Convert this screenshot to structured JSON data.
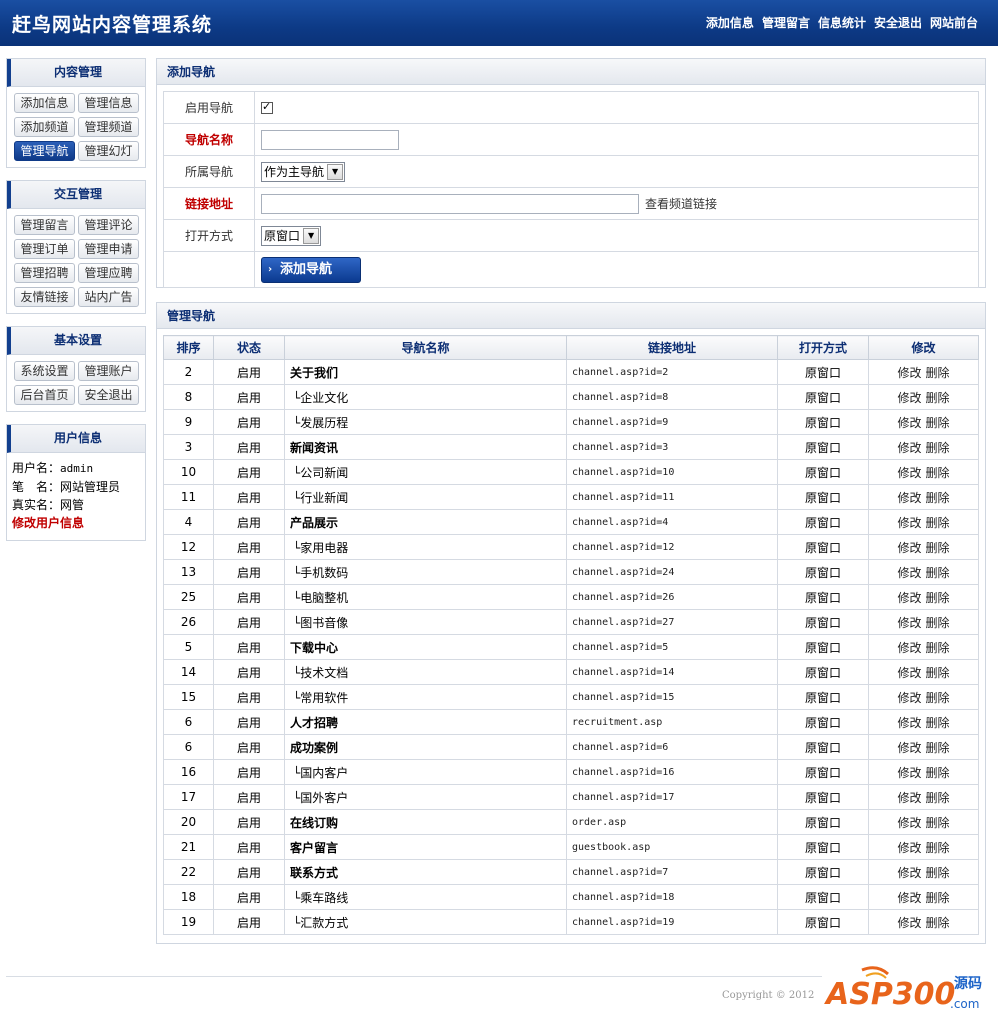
{
  "header": {
    "title": "赶鸟网站内容管理系统",
    "nav": [
      "添加信息",
      "管理留言",
      "信息统计",
      "安全退出",
      "网站前台"
    ]
  },
  "sidebar": {
    "groups": [
      {
        "title": "内容管理",
        "items": [
          "添加信息",
          "管理信息",
          "添加频道",
          "管理频道",
          "管理导航",
          "管理幻灯"
        ]
      },
      {
        "title": "交互管理",
        "items": [
          "管理留言",
          "管理评论",
          "管理订单",
          "管理申请",
          "管理招聘",
          "管理应聘",
          "友情链接",
          "站内广告"
        ]
      },
      {
        "title": "基本设置",
        "items": [
          "系统设置",
          "管理账户",
          "后台首页",
          "安全退出"
        ]
      }
    ],
    "active_item": "管理导航",
    "user": {
      "title": "用户信息",
      "username_label": "用户名：",
      "username": "admin",
      "role_label": "笔　名：",
      "role": "网站管理员",
      "realname_label": "真实名：",
      "realname": "网管",
      "edit_link": "修改用户信息"
    }
  },
  "add_form": {
    "title": "添加导航",
    "enable_label": "启用导航",
    "enable_checked": true,
    "name_label": "导航名称",
    "name_value": "",
    "parent_label": "所属导航",
    "parent_value": "作为主导航",
    "url_label": "链接地址",
    "url_value": "",
    "url_hint": "查看频道链接",
    "target_label": "打开方式",
    "target_value": "原窗口",
    "submit_label": "添加导航"
  },
  "manage": {
    "title": "管理导航",
    "columns": [
      "排序",
      "状态",
      "导航名称",
      "链接地址",
      "打开方式",
      "修改"
    ],
    "edit_label": "修改",
    "delete_label": "删除",
    "rows": [
      {
        "order": "2",
        "status": "启用",
        "name": "关于我们",
        "level": "top",
        "url": "channel.asp?id=2",
        "target": "原窗口"
      },
      {
        "order": "8",
        "status": "启用",
        "name": "└企业文化",
        "level": "child",
        "url": "channel.asp?id=8",
        "target": "原窗口"
      },
      {
        "order": "9",
        "status": "启用",
        "name": "└发展历程",
        "level": "child",
        "url": "channel.asp?id=9",
        "target": "原窗口"
      },
      {
        "order": "3",
        "status": "启用",
        "name": "新闻资讯",
        "level": "top",
        "url": "channel.asp?id=3",
        "target": "原窗口"
      },
      {
        "order": "10",
        "status": "启用",
        "name": "└公司新闻",
        "level": "child",
        "url": "channel.asp?id=10",
        "target": "原窗口"
      },
      {
        "order": "11",
        "status": "启用",
        "name": "└行业新闻",
        "level": "child",
        "url": "channel.asp?id=11",
        "target": "原窗口"
      },
      {
        "order": "4",
        "status": "启用",
        "name": "产品展示",
        "level": "top",
        "url": "channel.asp?id=4",
        "target": "原窗口"
      },
      {
        "order": "12",
        "status": "启用",
        "name": "└家用电器",
        "level": "child",
        "url": "channel.asp?id=12",
        "target": "原窗口"
      },
      {
        "order": "13",
        "status": "启用",
        "name": "└手机数码",
        "level": "child",
        "url": "channel.asp?id=24",
        "target": "原窗口"
      },
      {
        "order": "25",
        "status": "启用",
        "name": "└电脑整机",
        "level": "child",
        "url": "channel.asp?id=26",
        "target": "原窗口"
      },
      {
        "order": "26",
        "status": "启用",
        "name": "└图书音像",
        "level": "child",
        "url": "channel.asp?id=27",
        "target": "原窗口"
      },
      {
        "order": "5",
        "status": "启用",
        "name": "下载中心",
        "level": "top",
        "url": "channel.asp?id=5",
        "target": "原窗口"
      },
      {
        "order": "14",
        "status": "启用",
        "name": "└技术文档",
        "level": "child",
        "url": "channel.asp?id=14",
        "target": "原窗口"
      },
      {
        "order": "15",
        "status": "启用",
        "name": "└常用软件",
        "level": "child",
        "url": "channel.asp?id=15",
        "target": "原窗口"
      },
      {
        "order": "6",
        "status": "启用",
        "name": "人才招聘",
        "level": "top",
        "url": "recruitment.asp",
        "target": "原窗口"
      },
      {
        "order": "6",
        "status": "启用",
        "name": "成功案例",
        "level": "top",
        "url": "channel.asp?id=6",
        "target": "原窗口"
      },
      {
        "order": "16",
        "status": "启用",
        "name": "└国内客户",
        "level": "child",
        "url": "channel.asp?id=16",
        "target": "原窗口"
      },
      {
        "order": "17",
        "status": "启用",
        "name": "└国外客户",
        "level": "child",
        "url": "channel.asp?id=17",
        "target": "原窗口"
      },
      {
        "order": "20",
        "status": "启用",
        "name": "在线订购",
        "level": "top",
        "url": "order.asp",
        "target": "原窗口"
      },
      {
        "order": "21",
        "status": "启用",
        "name": "客户留言",
        "level": "top",
        "url": "guestbook.asp",
        "target": "原窗口"
      },
      {
        "order": "22",
        "status": "启用",
        "name": "联系方式",
        "level": "top",
        "url": "channel.asp?id=7",
        "target": "原窗口"
      },
      {
        "order": "18",
        "status": "启用",
        "name": "└乘车路线",
        "level": "child",
        "url": "channel.asp?id=18",
        "target": "原窗口"
      },
      {
        "order": "19",
        "status": "启用",
        "name": "└汇款方式",
        "level": "child",
        "url": "channel.asp?id=19",
        "target": "原窗口"
      }
    ]
  },
  "footer": {
    "copyright": "Copyright © 2012",
    "logo_text": "ASP300",
    "logo_sub": "源码",
    "logo_domain": ".com"
  },
  "colors": {
    "header_bg": "#0d3a86",
    "accent": "#123f8e",
    "required": "#c00000"
  }
}
